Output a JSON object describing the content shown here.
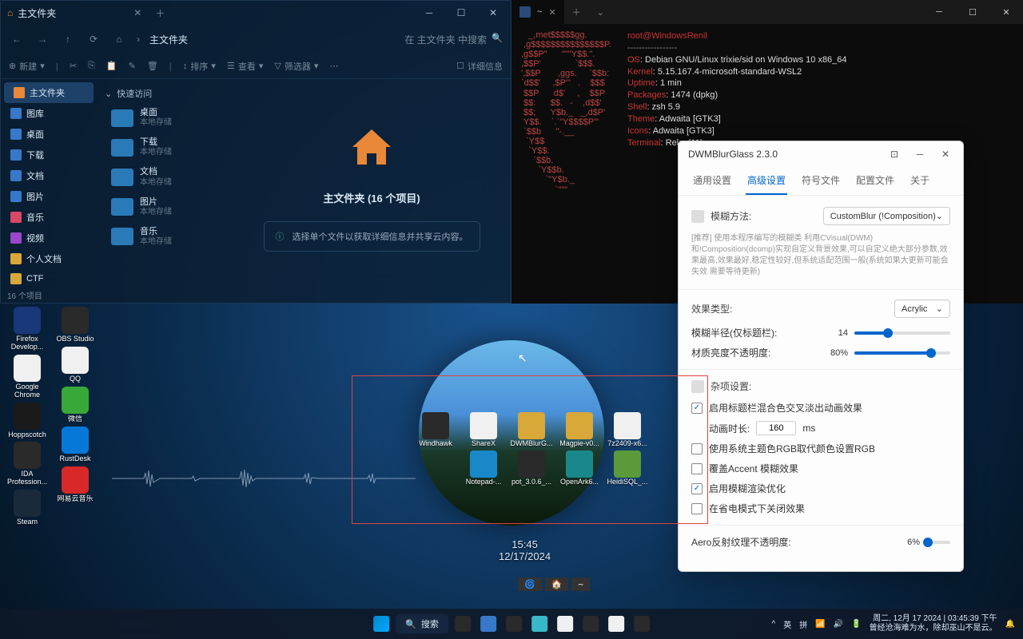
{
  "fileManager": {
    "title": "主文件夹",
    "breadcrumb": "主文件夹",
    "searchPlaceholder": "在 主文件夹 中搜索",
    "toolbar": {
      "new": "新建",
      "sort": "排序",
      "view": "查看",
      "filter": "筛选器",
      "details": "详细信息"
    },
    "sidebar": [
      {
        "label": "主文件夹",
        "color": "#e88838",
        "active": true
      },
      {
        "label": "图库",
        "color": "#3878c8"
      },
      {
        "label": "桌面",
        "color": "#3878c8"
      },
      {
        "label": "下载",
        "color": "#3878c8"
      },
      {
        "label": "文档",
        "color": "#3878c8"
      },
      {
        "label": "图片",
        "color": "#3878c8"
      },
      {
        "label": "音乐",
        "color": "#d84868"
      },
      {
        "label": "视频",
        "color": "#9848c8"
      },
      {
        "label": "个人文档",
        "color": "#d8a838"
      },
      {
        "label": "CTF",
        "color": "#d8a838"
      }
    ],
    "quickHeader": "快速访问",
    "quick": [
      {
        "label": "桌面",
        "sub": "本地存储"
      },
      {
        "label": "下载",
        "sub": "本地存储"
      },
      {
        "label": "文档",
        "sub": "本地存储"
      },
      {
        "label": "图片",
        "sub": "本地存储"
      },
      {
        "label": "音乐",
        "sub": "本地存储"
      }
    ],
    "infoTitle": "主文件夹 (16 个项目)",
    "infoHint": "选择单个文件以获取详细信息并共享云内容。",
    "status": "16 个项目"
  },
  "terminal": {
    "tabTitle": "~",
    "hostLine": "root@WindowsRenil",
    "ascii": "   _,met$$$$$gg.\n ,g$$$$$$$$$$$$$$$P.\n,g$$P\"      \"\"\"Y$$.\".\n,$$P'              `$$$.\n',$$P       ,ggs.     `$$b:\n`d$$'     ,$P\"'   .    $$$\n $$P      d$'     ,    $$P\n $$:      $$.   -    ,d$$'\n $$;      Y$b._   _,d$P'\n Y$$.    `.`\"Y$$$$P\"'\n `$$b      \"-.__\n  `Y$$\n   `Y$$.\n     `$$b.\n       `Y$$b.\n          `\"Y$b._\n              `\"\"\"",
    "info": [
      {
        "k": "OS",
        "v": "Debian GNU/Linux trixie/sid on Windows 10 x86_64"
      },
      {
        "k": "Kernel",
        "v": "5.15.167.4-microsoft-standard-WSL2"
      },
      {
        "k": "Uptime",
        "v": "1 min"
      },
      {
        "k": "Packages",
        "v": "1474 (dpkg)"
      },
      {
        "k": "Shell",
        "v": "zsh 5.9"
      },
      {
        "k": "Theme",
        "v": "Adwaita [GTK3]"
      },
      {
        "k": "Icons",
        "v": "Adwaita [GTK3]"
      },
      {
        "k": "Terminal",
        "v": "Relay(11)"
      }
    ],
    "promptSegs": [
      "🌀",
      "🏠",
      "~"
    ]
  },
  "dwm": {
    "title": "DWMBlurGlass 2.3.0",
    "tabs": [
      "通用设置",
      "高级设置",
      "符号文件",
      "配置文件",
      "关于"
    ],
    "activeTab": 1,
    "blurMethodLabel": "模糊方法:",
    "blurMethodValue": "CustomBlur (!Composition)",
    "blurDesc": "[推荐] 使用本程序编写的模糊类 利用CVisual(DWM)和!Composition(dcomp)实现自定义背景效果,可以自定义绝大部分参数,效果最高,效果最好,稳定性较好,但系统适配范围一般(系统如果大更新可能会失效 需要等待更新)",
    "effectTypeLabel": "效果类型:",
    "effectTypeValue": "Acrylic",
    "blurRadiusLabel": "模糊半径(仅标题栏):",
    "blurRadiusValue": "14",
    "materialOpacityLabel": "材质亮度不透明度:",
    "materialOpacityValue": "80%",
    "miscHeader": "杂项设置:",
    "checks": [
      {
        "label": "启用标题栏混合色交叉淡出动画效果",
        "checked": true
      },
      {
        "label": "使用系统主题色RGB取代颜色设置RGB",
        "checked": false
      },
      {
        "label": "覆盖Accent 模糊效果",
        "checked": false
      },
      {
        "label": "启用模糊渲染优化",
        "checked": true
      },
      {
        "label": "在省电模式下关闭效果",
        "checked": false
      }
    ],
    "animDurationLabel": "动画时长:",
    "animDurationValue": "160",
    "animDurationUnit": "ms",
    "aeroLabel": "Aero反射纹理不透明度:",
    "aeroValue": "6%"
  },
  "desktopIcons": {
    "col1": [
      {
        "label": "Firefox Develop...",
        "color": "#18387a"
      },
      {
        "label": "Google Chrome",
        "color": "#f0f0f0"
      },
      {
        "label": "Hoppscotch",
        "color": "#1a1a1a"
      },
      {
        "label": "IDA Profession...",
        "color": "#2a2a2a"
      },
      {
        "label": "Steam",
        "color": "#1a2a3a"
      }
    ],
    "col2": [
      {
        "label": "OBS Studio",
        "color": "#2a2a2a"
      },
      {
        "label": "QQ",
        "color": "#f0f0f0"
      },
      {
        "label": "微信",
        "color": "#38a838"
      },
      {
        "label": "RustDesk",
        "color": "#0878d8"
      },
      {
        "label": "网易云音乐",
        "color": "#d82828"
      }
    ]
  },
  "centerIcons": [
    {
      "label": "Windhawk",
      "color": "#2a2a2a"
    },
    {
      "label": "ShareX",
      "color": "#f0f0f0"
    },
    {
      "label": "DWMBlurG...",
      "color": "#d8a838"
    },
    {
      "label": "Magpie-v0...",
      "color": "#d8a838"
    },
    {
      "label": "7z2409-x6...",
      "color": "#f0f0f0"
    },
    {
      "label": "Notepad-...",
      "color": "#1888c8"
    },
    {
      "label": "pot_3.0.6_...",
      "color": "#2a2a2a"
    },
    {
      "label": "OpenArk6...",
      "color": "#1a888a"
    },
    {
      "label": "HeidiSQL_...",
      "color": "#5a9a3a"
    }
  ],
  "clockOverlay": {
    "time": "15:45",
    "date": "12/17/2024"
  },
  "taskbar": {
    "search": "搜索",
    "tray": {
      "chevron": "^",
      "lang1": "英",
      "lang2": "拼"
    },
    "datetime": {
      "line1": "周二, 12月 17 2024 | 03:45:39 下午",
      "line2": "曾经沧海难为水，除却巫山不是云。"
    }
  }
}
